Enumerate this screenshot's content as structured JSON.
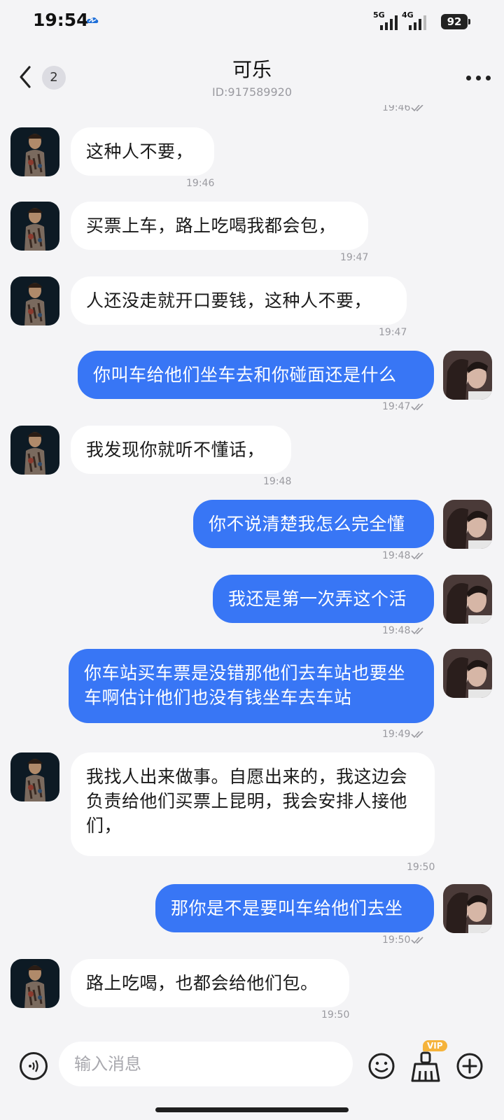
{
  "status_bar": {
    "time": "19:54",
    "network1": "5G",
    "network2": "4G",
    "battery": "92"
  },
  "header": {
    "back_badge": "2",
    "title": "可乐",
    "id_text": "ID:917589920"
  },
  "top_partial_timestamp": "19:46",
  "messages": [
    {
      "dir": "in",
      "text": "这种人不要，",
      "time": "19:46"
    },
    {
      "dir": "in",
      "text": "买票上车，路上吃喝我都会包，",
      "time": "19:47"
    },
    {
      "dir": "in",
      "text": "人还没走就开口要钱，这种人不要，",
      "time": "19:47"
    },
    {
      "dir": "out",
      "text": "你叫车给他们坐车去和你碰面还是什么",
      "time": "19:47"
    },
    {
      "dir": "in",
      "text": "我发现你就听不懂话，",
      "time": "19:48"
    },
    {
      "dir": "out",
      "text": "你不说清楚我怎么完全懂",
      "time": "19:48"
    },
    {
      "dir": "out",
      "text": "我还是第一次弄这个活",
      "time": "19:48"
    },
    {
      "dir": "out",
      "text": "你车站买车票是没错那他们去车站也要坐车啊估计他们也没有钱坐车去车站",
      "time": "19:49"
    },
    {
      "dir": "in",
      "text": "我找人出来做事。自愿出来的，我这边会负责给他们买票上昆明，我会安排人接他们，",
      "time": "19:50"
    },
    {
      "dir": "out",
      "text": "那你是不是要叫车给他们去坐",
      "time": "19:50"
    },
    {
      "dir": "in",
      "text": "路上吃喝，也都会给他们包。",
      "time": "19:50"
    }
  ],
  "input_bar": {
    "placeholder": "输入消息",
    "vip_label": "VIP"
  },
  "colors": {
    "outgoing_bubble": "#3876f5",
    "incoming_bubble": "#ffffff",
    "background": "#f4f4f6"
  }
}
